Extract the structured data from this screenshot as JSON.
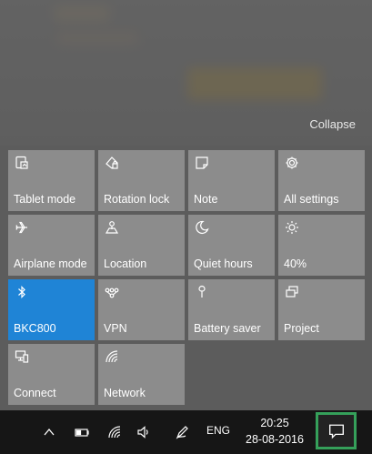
{
  "action_center": {
    "collapse_label": "Collapse",
    "tiles": [
      {
        "label": "Tablet mode",
        "icon": "tablet-mode-icon",
        "active": false
      },
      {
        "label": "Rotation lock",
        "icon": "rotation-lock-icon",
        "active": false
      },
      {
        "label": "Note",
        "icon": "note-icon",
        "active": false
      },
      {
        "label": "All settings",
        "icon": "gear-icon",
        "active": false
      },
      {
        "label": "Airplane mode",
        "icon": "airplane-icon",
        "active": false
      },
      {
        "label": "Location",
        "icon": "location-icon",
        "active": false
      },
      {
        "label": "Quiet hours",
        "icon": "moon-icon",
        "active": false
      },
      {
        "label": "40%",
        "icon": "brightness-icon",
        "active": false
      },
      {
        "label": "BKC800",
        "icon": "bluetooth-icon",
        "active": true
      },
      {
        "label": "VPN",
        "icon": "vpn-icon",
        "active": false
      },
      {
        "label": "Battery saver",
        "icon": "battery-saver-icon",
        "active": false
      },
      {
        "label": "Project",
        "icon": "project-icon",
        "active": false
      },
      {
        "label": "Connect",
        "icon": "connect-icon",
        "active": false
      },
      {
        "label": "Network",
        "icon": "network-icon",
        "active": false
      }
    ],
    "active_color": "#1f84d6",
    "tile_color": "#8c8c8c"
  },
  "taskbar": {
    "tray_icons": [
      "chevron-up-icon",
      "battery-icon",
      "wifi-icon",
      "volume-icon",
      "pen-icon"
    ],
    "language": "ENG",
    "time": "20:25",
    "date": "28-08-2016",
    "notification_icon": "action-center-icon",
    "highlight_color": "#35a05a"
  }
}
